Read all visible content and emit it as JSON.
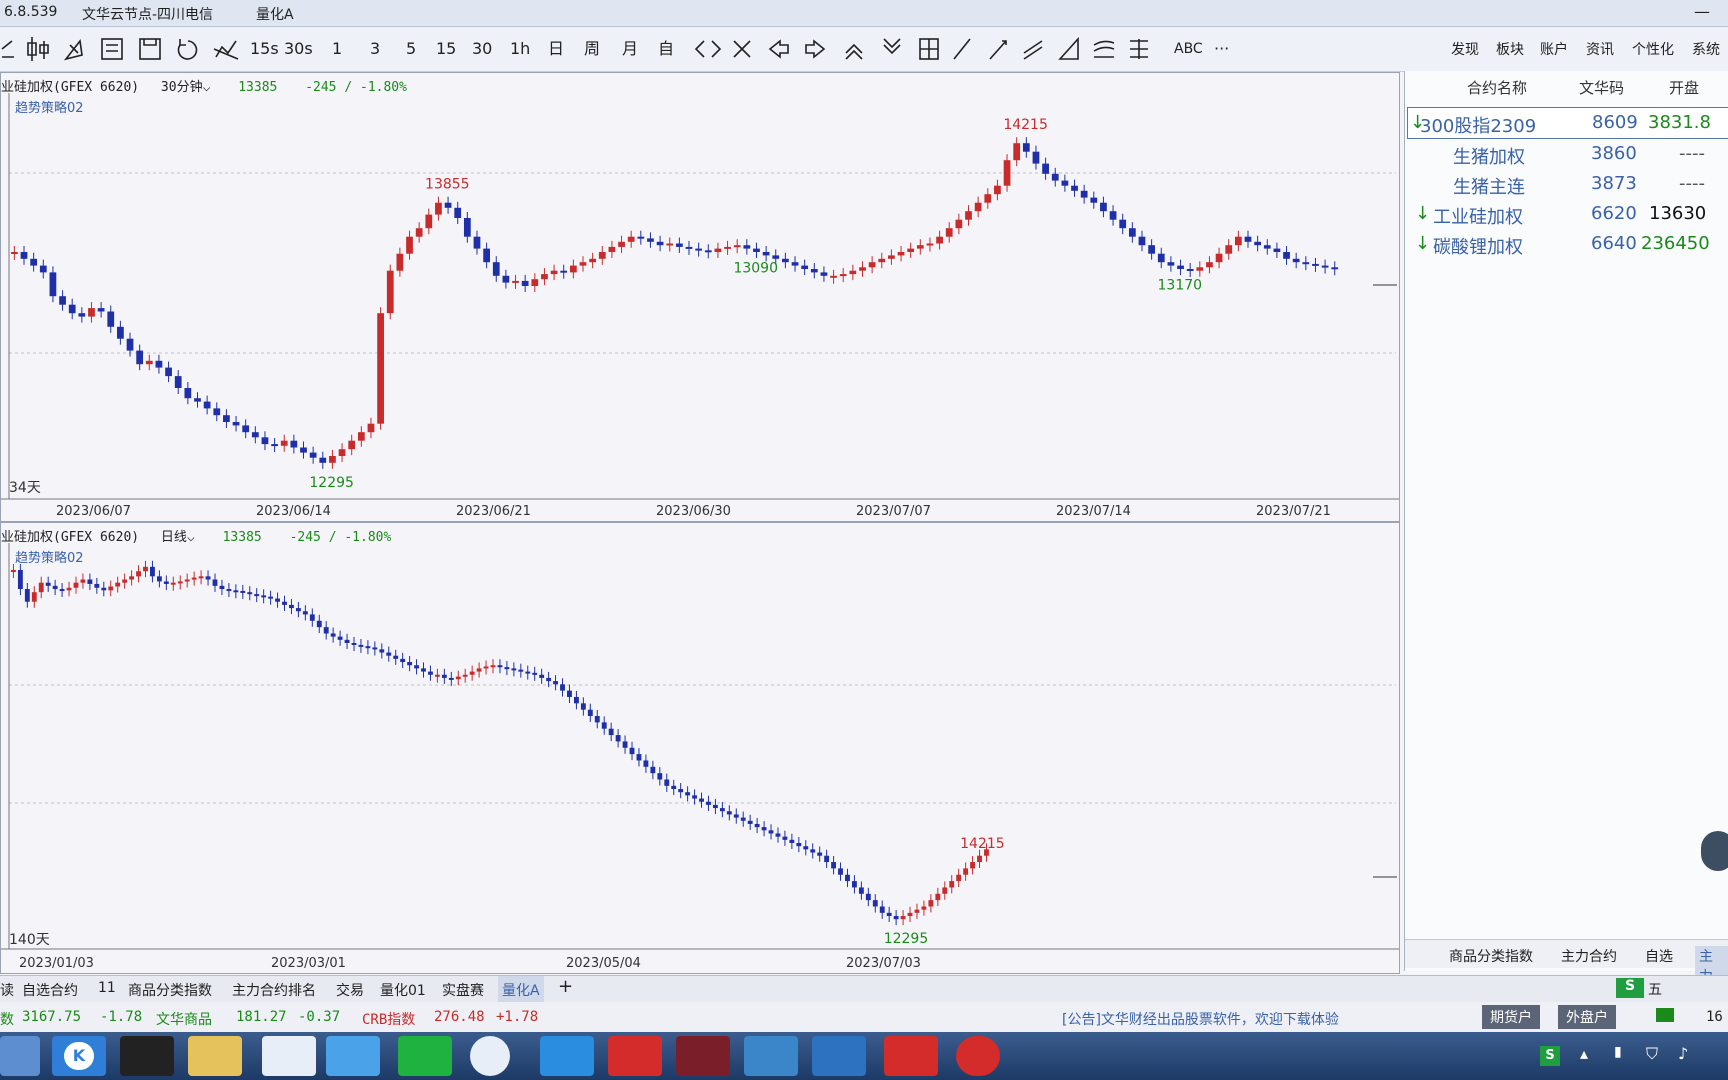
{
  "title": {
    "version": "6.8.539",
    "node": "文华云节点-四川电信",
    "window": "量化A"
  },
  "toolbar": {
    "buttons": [
      "15s",
      "30s",
      "1",
      "3",
      "5",
      "15",
      "30",
      "1h",
      "日",
      "周",
      "月",
      "自",
      "ABC",
      "···"
    ],
    "menu": [
      "发现",
      "板块",
      "账户",
      "资讯",
      "个性化",
      "系统"
    ]
  },
  "chart_top": {
    "header": {
      "contract": "业硅加权(GFEX 6620)",
      "period": "30分钟",
      "price": "13385",
      "change": "-245 / -1.80%"
    },
    "strategy": "趋势策略02",
    "days": "34天",
    "chart_data": {
      "type": "candlestick",
      "x": [
        "2023/06/07",
        "2023/06/14",
        "2023/06/21",
        "2023/06/30",
        "2023/07/07",
        "2023/07/14",
        "2023/07/21"
      ],
      "annotations": [
        {
          "label": "13855",
          "kind": "high"
        },
        {
          "label": "14215",
          "kind": "high"
        },
        {
          "label": "12295",
          "kind": "low"
        },
        {
          "label": "13090",
          "kind": "low"
        },
        {
          "label": "13170",
          "kind": "low"
        }
      ],
      "close_series": [
        13560,
        13520,
        13480,
        13440,
        13300,
        13250,
        13200,
        13180,
        13230,
        13210,
        13120,
        13050,
        12980,
        12900,
        12920,
        12880,
        12830,
        12760,
        12700,
        12680,
        12640,
        12600,
        12560,
        12540,
        12500,
        12470,
        12430,
        12420,
        12450,
        12410,
        12380,
        12350,
        12320,
        12360,
        12400,
        12450,
        12500,
        12550,
        13200,
        13450,
        13550,
        13650,
        13700,
        13780,
        13850,
        13820,
        13760,
        13650,
        13580,
        13500,
        13420,
        13380,
        13390,
        13360,
        13400,
        13430,
        13450,
        13440,
        13480,
        13500,
        13520,
        13560,
        13590,
        13620,
        13650,
        13640,
        13620,
        13600,
        13610,
        13590,
        13580,
        13570,
        13560,
        13580,
        13590,
        13600,
        13580,
        13560,
        13540,
        13520,
        13500,
        13480,
        13460,
        13440,
        13420,
        13420,
        13430,
        13450,
        13470,
        13500,
        13520,
        13540,
        13560,
        13580,
        13600,
        13610,
        13650,
        13700,
        13750,
        13800,
        13850,
        13900,
        13950,
        14100,
        14200,
        14150,
        14080,
        14020,
        13980,
        13950,
        13920,
        13880,
        13850,
        13800,
        13750,
        13700,
        13650,
        13600,
        13550,
        13500,
        13480,
        13460,
        13450,
        13470,
        13500,
        13550,
        13600,
        13650,
        13620,
        13600,
        13580,
        13560,
        13520,
        13500,
        13490,
        13480,
        13470,
        13460
      ]
    }
  },
  "chart_bottom": {
    "header": {
      "contract": "业硅加权(GFEX 6620)",
      "period": "日线",
      "price": "13385",
      "change": "-245 / -1.80%"
    },
    "strategy": "趋势策略02",
    "days": "140天",
    "chart_data": {
      "type": "candlestick",
      "x": [
        "2023/01/03",
        "2023/03/01",
        "2023/05/04",
        "2023/07/03"
      ],
      "annotations": [
        {
          "label": "14215",
          "kind": "high"
        },
        {
          "label": "12295",
          "kind": "low"
        }
      ],
      "close_series": [
        17800,
        17500,
        17300,
        17450,
        17600,
        17550,
        17500,
        17480,
        17520,
        17600,
        17650,
        17580,
        17520,
        17480,
        17540,
        17600,
        17650,
        17700,
        17780,
        17850,
        17700,
        17620,
        17580,
        17600,
        17620,
        17650,
        17680,
        17700,
        17650,
        17550,
        17500,
        17480,
        17470,
        17450,
        17420,
        17400,
        17380,
        17350,
        17300,
        17250,
        17200,
        17150,
        17100,
        17000,
        16900,
        16800,
        16750,
        16700,
        16650,
        16620,
        16600,
        16580,
        16550,
        16500,
        16450,
        16400,
        16350,
        16300,
        16250,
        16200,
        16150,
        16150,
        16100,
        16080,
        16120,
        16150,
        16200,
        16250,
        16280,
        16300,
        16270,
        16250,
        16230,
        16200,
        16180,
        16150,
        16100,
        16050,
        16000,
        15900,
        15800,
        15700,
        15600,
        15500,
        15400,
        15300,
        15200,
        15100,
        15000,
        14900,
        14800,
        14700,
        14600,
        14500,
        14400,
        14350,
        14300,
        14250,
        14200,
        14150,
        14100,
        14050,
        14000,
        13950,
        13900,
        13850,
        13800,
        13750,
        13700,
        13650,
        13600,
        13550,
        13500,
        13450,
        13400,
        13350,
        13300,
        13200,
        13100,
        13000,
        12900,
        12800,
        12700,
        12600,
        12500,
        12400,
        12350,
        12300,
        12350,
        12400,
        12450,
        12500,
        12600,
        12700,
        12800,
        12900,
        13000,
        13100,
        13200,
        13300,
        13400
      ]
    }
  },
  "watchlist": {
    "columns": [
      "合约名称",
      "文华码",
      "开盘"
    ],
    "rows": [
      {
        "name": "300股指2309",
        "code": "8609",
        "open": "3831.8",
        "arrow": "↓"
      },
      {
        "name": "生猪加权",
        "code": "3860",
        "open": "----",
        "arrow": ""
      },
      {
        "name": "生猪主连",
        "code": "3873",
        "open": "----",
        "arrow": ""
      },
      {
        "name": "工业硅加权",
        "code": "6620",
        "open": "13630",
        "arrow": "↓"
      },
      {
        "name": "碳酸锂加权",
        "code": "6640",
        "open": "236450",
        "arrow": "↓"
      }
    ],
    "tabs": [
      "商品分类指数",
      "主力合约",
      "自选",
      "主力"
    ]
  },
  "bottom_tabs": [
    "读",
    "自选合约",
    "11",
    "商品分类指数",
    "主力合约排名",
    "交易",
    "量化01",
    "实盘赛",
    "量化A",
    "+"
  ],
  "index_bar": {
    "items": [
      {
        "label": "数",
        "value": "3167.75",
        "change": "-1.78"
      },
      {
        "label": "文华商品",
        "value": "181.27",
        "change": "-0.37"
      },
      {
        "label": "CRB指数",
        "value": "276.48",
        "change": "+1.78"
      }
    ],
    "notice": "[公告]文华财经出品股票软件，欢迎下载体验",
    "buttons": [
      "期货户",
      "外盘户"
    ]
  },
  "taskbar": {
    "apps": [
      "K",
      "QQ",
      "Explorer",
      "Baidu",
      "Video",
      "iQIYI",
      "Chrome",
      "IE",
      "WPS",
      "Wenhua",
      "Pinwheel",
      "Layers",
      "Office",
      "Record"
    ],
    "tray": [
      "S",
      "五",
      "16"
    ]
  }
}
